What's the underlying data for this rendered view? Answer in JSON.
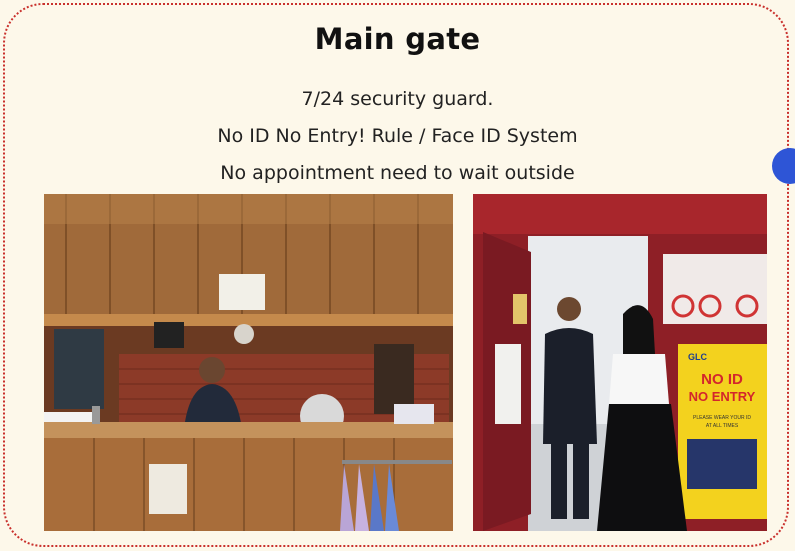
{
  "heading": {
    "title": "Main gate"
  },
  "description": {
    "line1": "7/24 security guard.",
    "line2": "No ID No Entry! Rule / Face ID System",
    "line3": "No appointment  need to wait outside"
  },
  "photos": {
    "left_alt": "Security guard booth with guard seated at desk",
    "right_alt": "Guard at open doorway speaking with visitor beside No ID No Entry sign"
  },
  "sign": {
    "brand": "GLC",
    "headline_1": "NO ID",
    "headline_2": "NO ENTRY",
    "note_1": "PLEASE WEAR YOUR ID",
    "note_2": "AT ALL TIMES"
  },
  "colors": {
    "accent_dot": "#2e55d6",
    "border": "#c9302c",
    "background": "#fdf8ea"
  }
}
